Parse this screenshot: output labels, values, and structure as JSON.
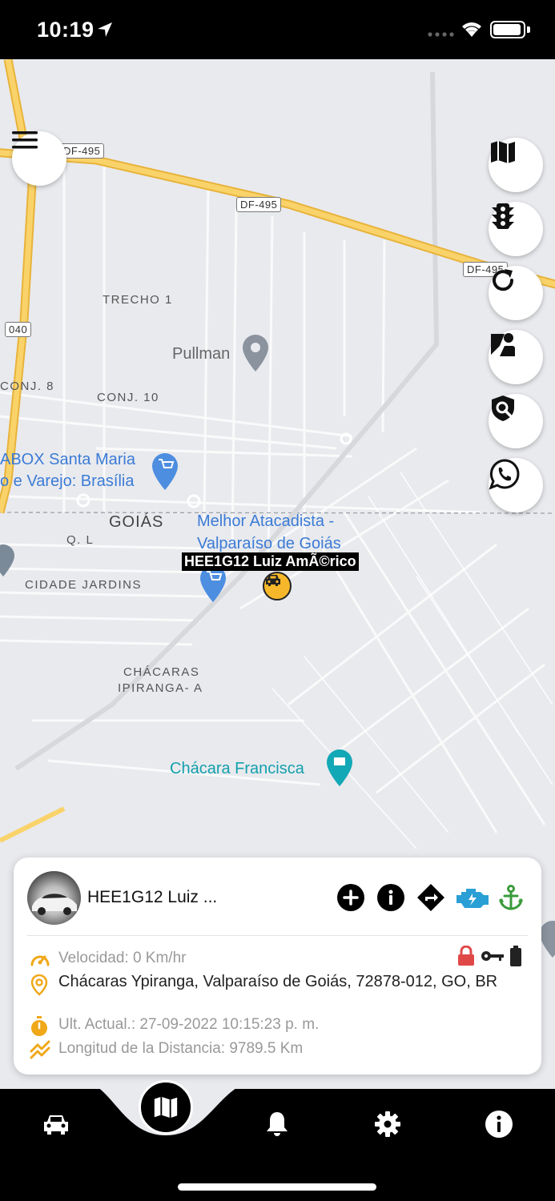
{
  "status_bar": {
    "time": "10:19"
  },
  "map": {
    "labels": {
      "trecho1": "TRECHO 1",
      "conj8": "CONJ. 8",
      "conj10": "CONJ. 10",
      "goias": "GOIÁS",
      "ql": "Q. L",
      "cidade_jardins": "CIDADE JARDINS",
      "chacaras_line1": "CHÁCARAS",
      "chacaras_line2": "IPIRANGA- A"
    },
    "roads": {
      "df495_a": "DF-495",
      "df495_b": "DF-495",
      "df495_c": "DF-495",
      "r040": "040"
    },
    "pois": {
      "pullman": "Pullman",
      "abox_line1": "ABOX Santa Maria",
      "abox_line2": "o e Varejo: Brasília",
      "melhor_line1": "Melhor Atacadista -",
      "melhor_line2": "Valparaíso de Goiás",
      "chacara_francisca": "Chácara Francisca"
    },
    "vehicle_label": "HEE1G12 Luiz AmÃ©rico"
  },
  "card": {
    "title": "HEE1G12 Luiz ...",
    "speed": "Velocidad: 0 Km/hr",
    "address": "Chácaras Ypiranga, Valparaíso de Goiás, 72878-012, GO, BR",
    "last_update": "Ult. Actual.: 27-09-2022 10:15:23 p. m.",
    "distance": "Longitud de la Distancia: 9789.5 Km"
  },
  "colors": {
    "accent": "#f6b82a",
    "engine": "#2a9fd6",
    "anchor": "#3a9b3a",
    "lock": "#e04848",
    "poi": "#3b7bd6",
    "road": "#f5c542"
  },
  "icons": [
    "menu-icon",
    "map-icon",
    "traffic-light-icon",
    "refresh-icon",
    "street-view-icon",
    "shield-search-icon",
    "whatsapp-icon",
    "plus-icon",
    "info-icon",
    "directions-icon",
    "engine-icon",
    "anchor-icon",
    "speedometer-icon",
    "location-pin-icon",
    "stopwatch-icon",
    "distance-icon",
    "lock-icon",
    "key-icon",
    "battery-icon",
    "car-icon",
    "bell-icon",
    "gear-icon"
  ]
}
